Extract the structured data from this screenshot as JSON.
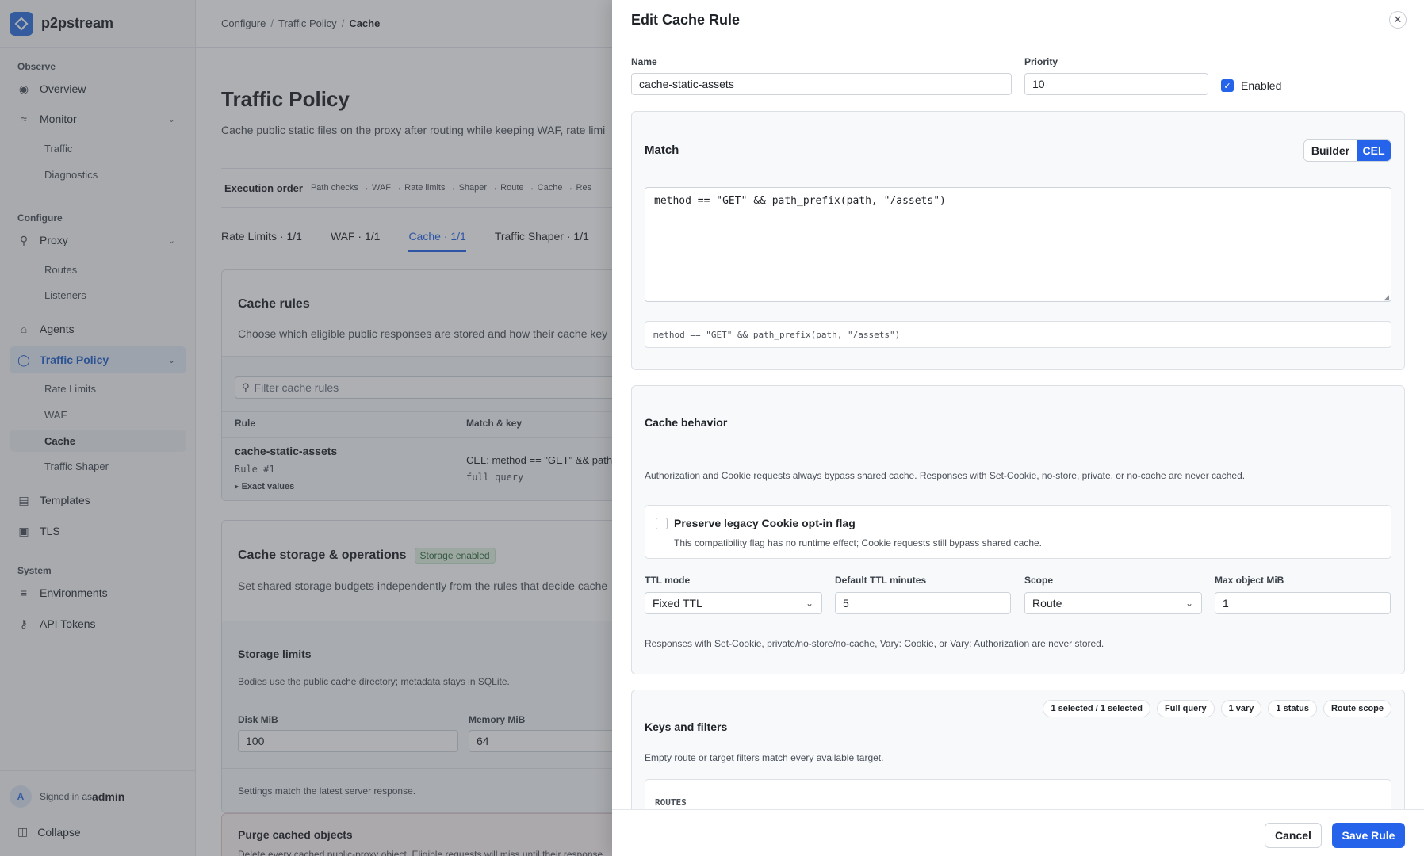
{
  "app": {
    "name": "p2pstream"
  },
  "sidebar": {
    "sections": {
      "observe": "Observe",
      "configure": "Configure",
      "system": "System"
    },
    "items": {
      "overview": "Overview",
      "monitor": "Monitor",
      "traffic": "Traffic",
      "diagnostics": "Diagnostics",
      "proxy": "Proxy",
      "routes": "Routes",
      "listeners": "Listeners",
      "agents": "Agents",
      "traffic_policy": "Traffic Policy",
      "rate_limits": "Rate Limits",
      "waf": "WAF",
      "cache": "Cache",
      "traffic_shaper": "Traffic Shaper",
      "templates": "Templates",
      "tls": "TLS",
      "environments": "Environments",
      "api_tokens": "API Tokens"
    },
    "footer": {
      "avatar_initial": "A",
      "signed_in_prefix": "Signed in as",
      "user": "admin",
      "collapse": "Collapse"
    }
  },
  "breadcrumb": {
    "item1": "Configure",
    "item2": "Traffic Policy",
    "current": "Cache"
  },
  "page": {
    "title": "Traffic Policy",
    "description": "Cache public static files on the proxy after routing while keeping WAF, rate limi",
    "execution_order_label": "Execution order",
    "execution_order": "Path checks → WAF → Rate limits → Shaper → Route → Cache → Res",
    "tabs": [
      "Rate Limits · 1/1",
      "WAF · 1/1",
      "Cache · 1/1",
      "Traffic Shaper · 1/1"
    ],
    "cache_rules": {
      "title": "Cache rules",
      "description": "Choose which eligible public responses are stored and how their cache key",
      "filter_placeholder": "Filter cache rules",
      "col_rule": "Rule",
      "col_match": "Match & key",
      "row": {
        "name": "cache-static-assets",
        "number": "Rule #1",
        "exact": "Exact values",
        "match": "CEL: method == \"GET\" && path_",
        "key": "full query"
      }
    },
    "storage": {
      "title": "Cache storage & operations",
      "badge": "Storage enabled",
      "description": "Set shared storage budgets independently from the rules that decide cache",
      "limits_title": "Storage limits",
      "limits_desc": "Bodies use the public cache directory; metadata stays in SQLite.",
      "disk_label": "Disk MiB",
      "disk_value": "100",
      "memory_label": "Memory MiB",
      "memory_value": "64",
      "settings_note": "Settings match the latest server response."
    },
    "purge": {
      "title": "Purge cached objects",
      "description": "Delete every cached public-proxy object. Eligible requests will miss until their response"
    }
  },
  "drawer": {
    "title": "Edit Cache Rule",
    "name_label": "Name",
    "name_value": "cache-static-assets",
    "priority_label": "Priority",
    "priority_value": "10",
    "enabled_label": "Enabled",
    "match": {
      "title": "Match",
      "mode_builder": "Builder",
      "mode_cel": "CEL",
      "expression": "method == \"GET\" && path_prefix(path, \"/assets\")",
      "preview": "method == \"GET\" && path_prefix(path, \"/assets\")"
    },
    "behavior": {
      "title": "Cache behavior",
      "note": "Authorization and Cookie requests always bypass shared cache. Responses with Set-Cookie, no-store, private, or no-cache are never cached.",
      "legacy_title": "Preserve legacy Cookie opt-in flag",
      "legacy_desc": "This compatibility flag has no runtime effect; Cookie requests still bypass shared cache.",
      "ttl_mode_label": "TTL mode",
      "ttl_mode_value": "Fixed TTL",
      "default_ttl_label": "Default TTL minutes",
      "default_ttl_value": "5",
      "scope_label": "Scope",
      "scope_value": "Route",
      "max_object_label": "Max object MiB",
      "max_object_value": "1",
      "footnote": "Responses with Set-Cookie, private/no-store/no-cache, Vary: Cookie, or Vary: Authorization are never stored."
    },
    "keys": {
      "title": "Keys and filters",
      "chips": [
        "1 selected / 1 selected",
        "Full query",
        "1 vary",
        "1 status",
        "Route scope"
      ],
      "description": "Empty route or target filters match every available target.",
      "routes_label": "ROUTES"
    },
    "cancel": "Cancel",
    "save": "Save Rule"
  },
  "colors": {
    "accent": "#2563eb",
    "badge_bg": "#e3f1e4",
    "badge_text": "#2f6b3a"
  }
}
